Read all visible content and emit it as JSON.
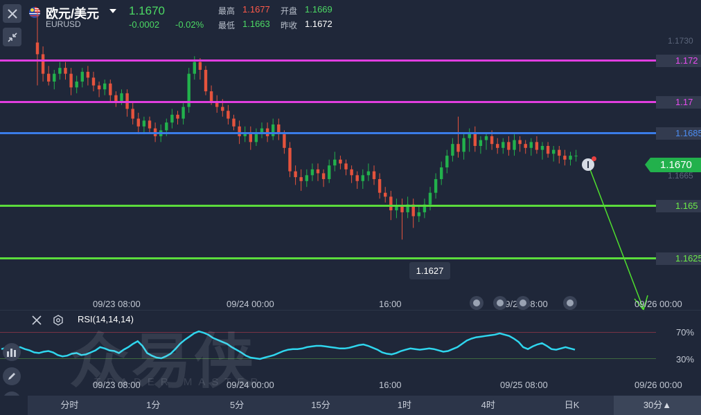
{
  "header": {
    "pair_title": "欧元/美元",
    "pair_code": "EURUSD",
    "price": "1.1670",
    "change": "-0.0002",
    "change_pct": "-0.02%",
    "stats": {
      "high_label": "最高",
      "high_value": "1.1677",
      "open_label": "开盘",
      "open_value": "1.1669",
      "low_label": "最低",
      "low_value": "1.1663",
      "prev_close_label": "昨收",
      "prev_close_value": "1.1672"
    }
  },
  "price_lines": [
    {
      "label": "1.172",
      "color": "#e13ee0"
    },
    {
      "label": "1.17",
      "color": "#e13ee0"
    },
    {
      "label": "1.1685",
      "color": "#3a7ce8"
    },
    {
      "label": "1.165",
      "color": "#5bdc3c"
    },
    {
      "label": "1.1625",
      "color": "#5bdc3c"
    }
  ],
  "axis_ticks": [
    "1.1730",
    "1.1665"
  ],
  "current_price_tag": "1.1670",
  "low_marker": "1.1627",
  "time_labels": [
    "09/23 08:00",
    "09/24 00:00",
    "16:00",
    "09/25 08:00",
    "09/26 00:00"
  ],
  "rsi": {
    "label": "RSI(14,14,14)",
    "upper": "70%",
    "lower": "30%",
    "values": [
      44,
      46,
      41,
      45,
      47,
      44,
      42,
      39,
      38,
      40,
      41,
      39,
      35,
      33,
      34,
      37,
      38,
      35,
      36,
      39,
      42,
      47,
      45,
      42,
      41,
      38,
      43,
      47,
      52,
      56,
      49,
      38,
      34,
      31,
      30,
      33,
      37,
      44,
      52,
      58,
      63,
      68,
      71,
      69,
      66,
      61,
      58,
      55,
      52,
      47,
      43,
      39,
      34,
      31,
      30,
      29,
      31,
      33,
      35,
      38,
      41,
      43,
      44,
      44,
      45,
      47,
      48,
      49,
      49,
      48,
      47,
      46,
      45,
      45,
      46,
      48,
      50,
      51,
      49,
      46,
      43,
      39,
      37,
      36,
      38,
      41,
      43,
      45,
      44,
      43,
      44,
      45,
      44,
      42,
      40,
      41,
      44,
      47,
      52,
      57,
      60,
      62,
      63,
      64,
      65,
      66,
      68,
      66,
      64,
      60,
      55,
      47,
      44,
      48,
      51,
      53,
      49,
      44,
      43,
      45,
      47,
      45,
      43
    ],
    "scale": [
      0,
      100
    ]
  },
  "candles": {
    "opens": [
      1.1728,
      1.1722,
      1.1712,
      1.1708,
      1.1712,
      1.1715,
      1.1712,
      1.1705,
      1.1708,
      1.1713,
      1.171,
      1.1706,
      1.1704,
      1.1707,
      1.1701,
      1.1698,
      1.1702,
      1.1694,
      1.1689,
      1.1685,
      1.1688,
      1.1684,
      1.168,
      1.1683,
      1.1687,
      1.1691,
      1.1689,
      1.1695,
      1.1712,
      1.1718,
      1.1714,
      1.1703,
      1.1698,
      1.1695,
      1.1693,
      1.1689,
      1.1685,
      1.168,
      1.1682,
      1.1677,
      1.1681,
      1.1684,
      1.168,
      1.1686,
      1.1681,
      1.1674,
      1.1662,
      1.1659,
      1.1657,
      1.166,
      1.1663,
      1.1661,
      1.1658,
      1.1665,
      1.1668,
      1.1666,
      1.1663,
      1.166,
      1.1657,
      1.166,
      1.1662,
      1.1658,
      1.1651,
      1.1649,
      1.1642,
      1.1644,
      1.1641,
      1.1645,
      1.1639,
      1.1641,
      1.1645,
      1.1651,
      1.1658,
      1.1664,
      1.167,
      1.1676,
      1.1672,
      1.1679,
      1.1682,
      1.1675,
      1.1678,
      1.168,
      1.1676,
      1.1674,
      1.1677,
      1.1673,
      1.1678,
      1.1676,
      1.1674,
      1.1677,
      1.1673,
      1.1675,
      1.1671,
      1.1673,
      1.167,
      1.1668,
      1.167
    ],
    "closes": [
      1.1722,
      1.1712,
      1.1708,
      1.1712,
      1.1715,
      1.1712,
      1.1705,
      1.1708,
      1.1713,
      1.171,
      1.1706,
      1.1704,
      1.1707,
      1.1701,
      1.1698,
      1.1702,
      1.1694,
      1.1689,
      1.1685,
      1.1688,
      1.1684,
      1.168,
      1.1683,
      1.1687,
      1.1691,
      1.1689,
      1.1695,
      1.1712,
      1.1718,
      1.1714,
      1.1703,
      1.1698,
      1.1695,
      1.1693,
      1.1689,
      1.1685,
      1.168,
      1.1682,
      1.1677,
      1.1681,
      1.1684,
      1.168,
      1.1686,
      1.1681,
      1.1674,
      1.1662,
      1.1659,
      1.1657,
      1.166,
      1.1663,
      1.1661,
      1.1658,
      1.1665,
      1.1668,
      1.1666,
      1.1663,
      1.166,
      1.1657,
      1.166,
      1.1662,
      1.1658,
      1.1651,
      1.1649,
      1.1642,
      1.1644,
      1.1641,
      1.1645,
      1.1639,
      1.1641,
      1.1645,
      1.1651,
      1.1658,
      1.1664,
      1.167,
      1.1676,
      1.1672,
      1.1679,
      1.1682,
      1.1675,
      1.1678,
      1.168,
      1.1676,
      1.1674,
      1.1677,
      1.1673,
      1.1678,
      1.1676,
      1.1674,
      1.1677,
      1.1673,
      1.1675,
      1.1671,
      1.1673,
      1.167,
      1.1668,
      1.167,
      1.167
    ],
    "highs": [
      1.1745,
      1.1726,
      1.1716,
      1.1714,
      1.1718,
      1.1718,
      1.1715,
      1.1711,
      1.1715,
      1.1716,
      1.1713,
      1.1708,
      1.1709,
      1.1709,
      1.1703,
      1.1704,
      1.1704,
      1.1697,
      1.1692,
      1.169,
      1.169,
      1.1687,
      1.1686,
      1.1689,
      1.1694,
      1.1693,
      1.1698,
      1.1715,
      1.1721,
      1.172,
      1.1716,
      1.1706,
      1.1701,
      1.1699,
      1.1696,
      1.1691,
      1.1688,
      1.1685,
      1.1685,
      1.1684,
      1.1687,
      1.1687,
      1.1689,
      1.1689,
      1.1683,
      1.1677,
      1.1665,
      1.1663,
      1.1663,
      1.1666,
      1.1666,
      1.1663,
      1.1668,
      1.1672,
      1.167,
      1.1668,
      1.1665,
      1.1662,
      1.1663,
      1.1666,
      1.1665,
      1.1661,
      1.1654,
      1.1652,
      1.1648,
      1.1648,
      1.1649,
      1.1648,
      1.1644,
      1.1648,
      1.1654,
      1.1661,
      1.1667,
      1.1673,
      1.1679,
      1.169,
      1.1682,
      1.1684,
      1.1685,
      1.168,
      1.1682,
      1.1683,
      1.1679,
      1.1679,
      1.168,
      1.1681,
      1.168,
      1.1678,
      1.1679,
      1.168,
      1.1677,
      1.1677,
      1.1675,
      1.1675,
      1.1673,
      1.1672,
      1.1673
    ],
    "lows": [
      1.1706,
      1.1708,
      1.1706,
      1.1704,
      1.1709,
      1.1709,
      1.1701,
      1.1702,
      1.1705,
      1.1706,
      1.1703,
      1.17,
      1.1701,
      1.1698,
      1.1695,
      1.1696,
      1.169,
      1.1686,
      1.1681,
      1.1681,
      1.1682,
      1.1677,
      1.1677,
      1.168,
      1.1684,
      1.1686,
      1.1686,
      1.1692,
      1.1709,
      1.1709,
      1.1701,
      1.1696,
      1.1692,
      1.169,
      1.1686,
      1.1683,
      1.1676,
      1.1677,
      1.1673,
      1.1675,
      1.1679,
      1.1677,
      1.1678,
      1.1678,
      1.1671,
      1.1659,
      1.1655,
      1.1652,
      1.1654,
      1.1657,
      1.1657,
      1.1654,
      1.1656,
      1.1662,
      1.1663,
      1.166,
      1.1656,
      1.1653,
      1.1653,
      1.1657,
      1.1655,
      1.1648,
      1.1646,
      1.1637,
      1.1638,
      1.1627,
      1.1638,
      1.1633,
      1.1636,
      1.1638,
      1.1642,
      1.1648,
      1.1655,
      1.1661,
      1.1667,
      1.1669,
      1.1668,
      1.1672,
      1.1672,
      1.1671,
      1.1673,
      1.1673,
      1.1671,
      1.1671,
      1.167,
      1.167,
      1.1672,
      1.1671,
      1.167,
      1.1671,
      1.1668,
      1.1669,
      1.1667,
      1.1666,
      1.1665,
      1.1665,
      1.1667
    ]
  },
  "price_scale": [
    1.1608,
    1.1742
  ],
  "tabs": [
    "分时",
    "1分",
    "5分",
    "15分",
    "1时",
    "4时",
    "日K"
  ],
  "active_tab": "30分▲",
  "watermark": {
    "main": "众易侠",
    "sub": "TRADER MASTER"
  },
  "colors": {
    "up": "#22b14c",
    "down": "#e5533d",
    "rsi": "#2fd6ee",
    "bg": "#1f2739"
  }
}
